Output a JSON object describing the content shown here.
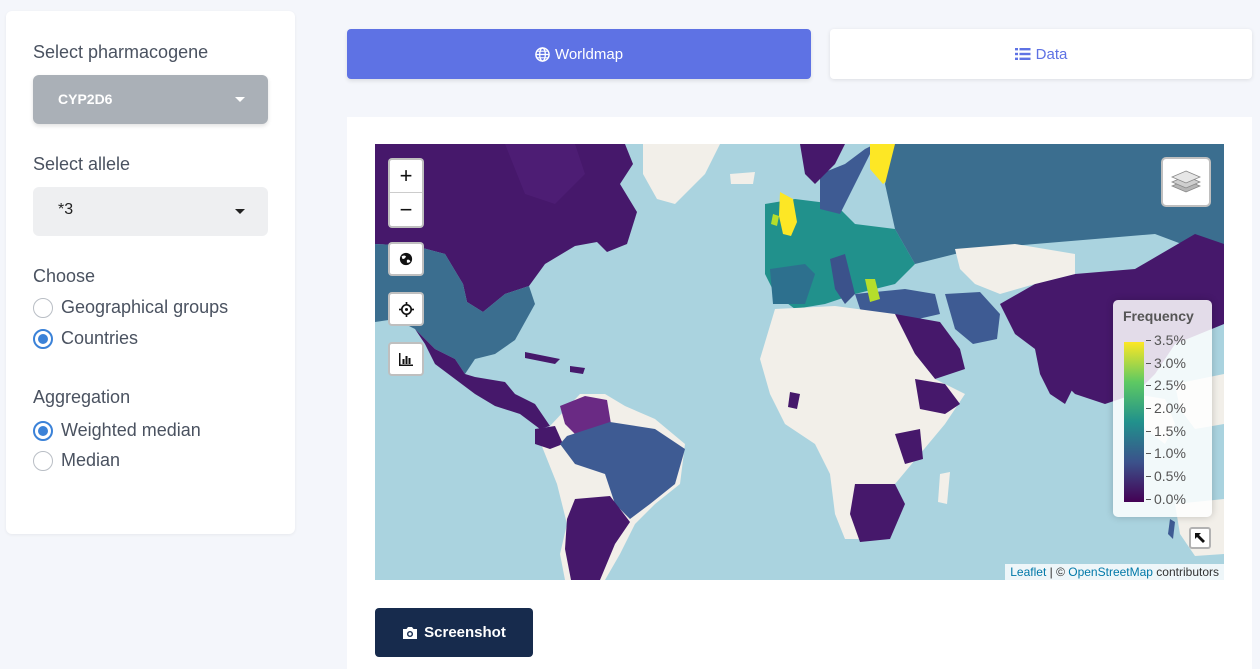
{
  "sidebar": {
    "gene_label": "Select pharmacogene",
    "gene_value": "CYP2D6",
    "allele_label": "Select allele",
    "allele_value": "*3",
    "choose_label": "Choose",
    "choose_options": [
      "Geographical groups",
      "Countries"
    ],
    "choose_selected": "Countries",
    "aggregation_label": "Aggregation",
    "aggregation_options": [
      "Weighted median",
      "Median"
    ],
    "aggregation_selected": "Weighted median"
  },
  "tabs": {
    "worldmap": "Worldmap",
    "data": "Data",
    "active": "Worldmap"
  },
  "map": {
    "zoom_in": "+",
    "zoom_out": "−",
    "legend": {
      "title": "Frequency",
      "ticks": [
        "3.5%",
        "3.0%",
        "2.5%",
        "2.0%",
        "1.5%",
        "1.0%",
        "0.5%",
        "0.0%"
      ],
      "palette": [
        "#fde725",
        "#5ec962",
        "#21918c",
        "#3b528b",
        "#440154"
      ]
    },
    "attribution": {
      "leaflet": "Leaflet",
      "sep": " | © ",
      "osm": "OpenStreetMap",
      "suffix": " contributors"
    },
    "colors": {
      "ocean": "#aad3df",
      "land_nodata": "#f2efe9",
      "teal_dark": "#3b6e8f"
    }
  },
  "screenshot_label": "Screenshot"
}
